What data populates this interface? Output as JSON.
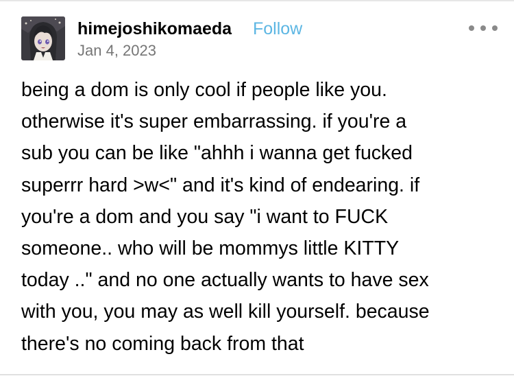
{
  "post": {
    "blog_name": "himejoshikomaeda",
    "follow_label": "Follow",
    "date": "Jan 4, 2023",
    "menu_icon": "more-horizontal-icon",
    "avatar": "avatar-icon",
    "body_lines": [
      "being a dom is only cool if people like you.",
      "otherwise it's super embarrassing. if you're a",
      "sub you can be like \"ahhh i wanna get fucked",
      "superrr hard >w<\" and it's kind of endearing. if",
      "you're a dom and you say \"i want to FUCK",
      "someone.. who will be mommys little KITTY",
      "today ..\" and no one actually wants to have sex",
      "with you, you may as well kill yourself. because",
      "there's no coming back from that"
    ]
  },
  "colors": {
    "follow": "#5cb6e3",
    "date": "#767676",
    "menu_dots": "#8a8a8a",
    "divider": "#e0e0e0"
  }
}
